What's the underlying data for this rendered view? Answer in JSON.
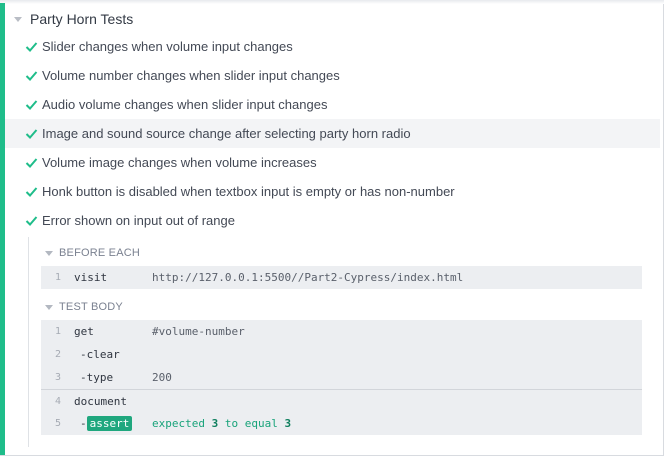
{
  "suite": {
    "title": "Party Horn Tests",
    "caret_icon": "caret-down-icon"
  },
  "tests": [
    {
      "label": "Slider changes when volume input changes",
      "status": "passed"
    },
    {
      "label": "Volume number changes when slider input changes",
      "status": "passed"
    },
    {
      "label": "Audio volume changes when slider input changes",
      "status": "passed"
    },
    {
      "label": "Image and sound source change after selecting party horn radio",
      "status": "passed"
    },
    {
      "label": "Volume image changes when volume increases",
      "status": "passed"
    },
    {
      "label": "Honk button is disabled when textbox input is empty or has non-number",
      "status": "passed"
    },
    {
      "label": "Error shown on input out of range",
      "status": "passed"
    }
  ],
  "before_each": {
    "title": "BEFORE EACH",
    "commands": [
      {
        "num": "1",
        "name": "visit",
        "message": "http://127.0.0.1:5500//Part2-Cypress/index.html"
      }
    ]
  },
  "test_body": {
    "title": "TEST BODY",
    "commands": [
      {
        "num": "1",
        "name": "get",
        "message": "#volume-number"
      },
      {
        "num": "2",
        "name": "-clear",
        "message": ""
      },
      {
        "num": "3",
        "name": "-type",
        "message": "200"
      },
      {
        "num": "4",
        "name": "document",
        "message": ""
      },
      {
        "num": "5",
        "name_prefix": "-",
        "name": "assert",
        "message_parts": [
          "expected",
          "3",
          "to equal",
          "3"
        ]
      }
    ]
  },
  "colors": {
    "pass": "#1fbd8a",
    "assert_badge": "#1fa77e",
    "command_bg": "#eceef1"
  }
}
